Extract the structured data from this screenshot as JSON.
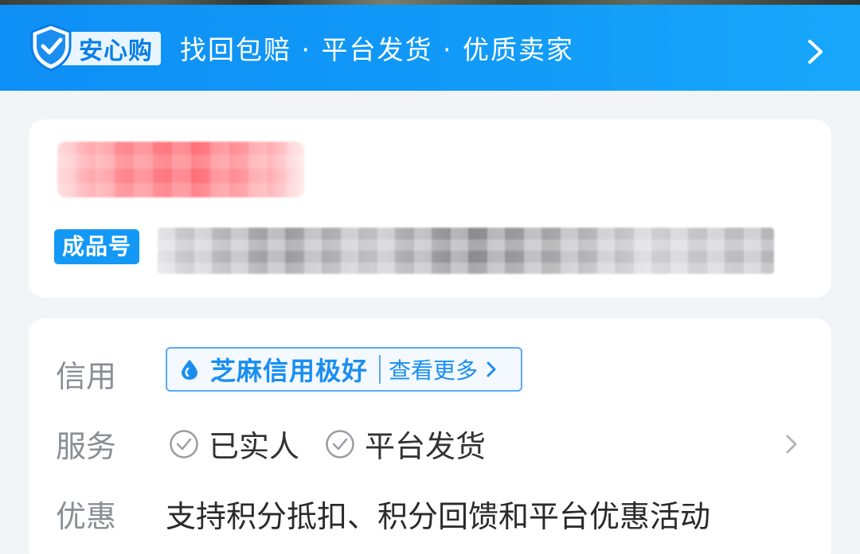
{
  "banner": {
    "badge_label": "安心购",
    "text": "找回包赔 · 平台发货 · 优质卖家",
    "badge_icon": "shield-check-icon",
    "chevron_icon": "chevron-right-icon",
    "background_color": "#119af8"
  },
  "product": {
    "title": "",
    "number_label": "成品号",
    "number_value": ""
  },
  "info": {
    "credit": {
      "label": "信用",
      "value": "芝麻信用极好",
      "more": "查看更多",
      "icon": "sesame-drop-icon"
    },
    "service": {
      "label": "服务",
      "items": [
        "已实人",
        "平台发货"
      ],
      "item_icon": "check-circle-icon"
    },
    "promo": {
      "label": "优惠",
      "text": "支持积分抵扣、积分回馈和平台优惠活动"
    }
  },
  "colors": {
    "accent": "#1399f5",
    "page_bg": "#f3f4f8"
  }
}
